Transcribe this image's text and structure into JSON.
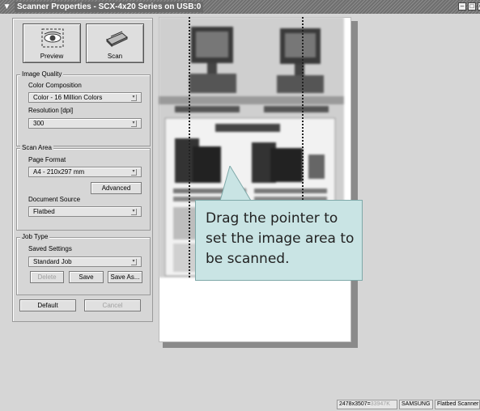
{
  "window": {
    "title": "Scanner Properties - SCX-4x20 Series on USB:0",
    "menu_glyph": "▼",
    "minimize_glyph": "–",
    "maximize_glyph": "□",
    "close_glyph": "×"
  },
  "toolbar": {
    "preview_label": "Preview",
    "scan_label": "Scan"
  },
  "image_quality": {
    "title": "Image Quality",
    "color_label": "Color Composition",
    "color_value": "Color - 16 Million Colors",
    "resolution_label": "Resolution [dpi]",
    "resolution_value": "300"
  },
  "scan_area": {
    "title": "Scan Area",
    "format_label": "Page Format",
    "format_value": "A4 - 210x297 mm",
    "advanced_label": "Advanced",
    "source_label": "Document Source",
    "source_value": "Flatbed"
  },
  "job_type": {
    "title": "Job Type",
    "saved_label": "Saved Settings",
    "saved_value": "Standard Job",
    "delete_label": "Delete",
    "save_label": "Save",
    "saveas_label": "Save As..."
  },
  "footer": {
    "default_label": "Default",
    "cancel_label": "Cancel"
  },
  "callout": {
    "text": "Drag the pointer to set the image area to be scanned."
  },
  "status": {
    "dimensions": "2478x3507=",
    "size": "33947K",
    "brand": "SAMSUNG",
    "scanner": "Flatbed Scanner"
  },
  "colors": {
    "window_bg": "#d6d6d6",
    "callout_bg": "#c9e4e4",
    "status_size_color": "#a0a0a0"
  }
}
